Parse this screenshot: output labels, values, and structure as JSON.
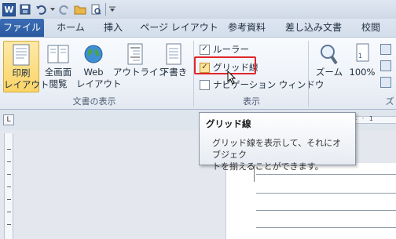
{
  "qat": {
    "app_icon_letter": "W"
  },
  "tabs": [
    {
      "label": "ファイル"
    },
    {
      "label": "ホーム"
    },
    {
      "label": "挿入"
    },
    {
      "label": "ページ レイアウト"
    },
    {
      "label": "参考資料"
    },
    {
      "label": "差し込み文書"
    },
    {
      "label": "校閲"
    }
  ],
  "ribbon": {
    "view_group": {
      "label": "文書の表示",
      "buttons": [
        {
          "line1": "印刷",
          "line2": "レイアウト"
        },
        {
          "line1": "全画面",
          "line2": "閲覧"
        },
        {
          "line1": "Web",
          "line2": "レイアウト"
        },
        {
          "line1": "アウトライン",
          "line2": ""
        },
        {
          "line1": "下書き",
          "line2": ""
        }
      ]
    },
    "show_group": {
      "label": "表示",
      "checkboxes": [
        {
          "label": "ルーラー",
          "checked": true
        },
        {
          "label": "グリッド線",
          "checked": true
        },
        {
          "label": "ナビゲーション ウィンドウ",
          "checked": false
        }
      ]
    },
    "zoom_group": {
      "label": "ズ",
      "zoom_label": "ズーム",
      "percent_label": "100%"
    }
  },
  "ruler": {
    "marks": "· 4 · 1"
  },
  "tooltip": {
    "title": "グリッド線",
    "body_line1": "グリッド線を表示して、それにオブジェク",
    "body_line2": "トを揃えることができます。"
  },
  "colors": {
    "file_tab": "#2a5aa0",
    "highlight_border": "#e0262a",
    "active_button": "#fbd466"
  }
}
